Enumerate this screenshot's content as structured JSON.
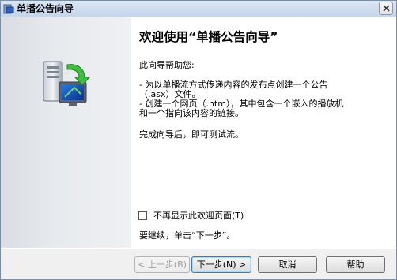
{
  "window": {
    "title": "单播公告向导"
  },
  "content": {
    "heading": "欢迎使用“单播公告向导”",
    "intro": "此向导帮助您:",
    "bullet1_line1": "- 为以单播流方式传递内容的发布点创建一个公告",
    "bullet1_line2": "（.asx）文件。",
    "bullet2_line1": "- 创建一个网页（.htm），其中包含一个嵌入的播放机",
    "bullet2_line2": "和一个指向该内容的链接。",
    "completion": "完成向导后，即可测试流。",
    "checkbox_label": "不再显示此欢迎页面(T)",
    "checkbox_checked": false,
    "continue_text": "要继续，单击“下一步”。"
  },
  "buttons": {
    "back": "< 上一步(B)",
    "next": "下一步(N) >",
    "cancel": "取消",
    "help": "帮助"
  }
}
